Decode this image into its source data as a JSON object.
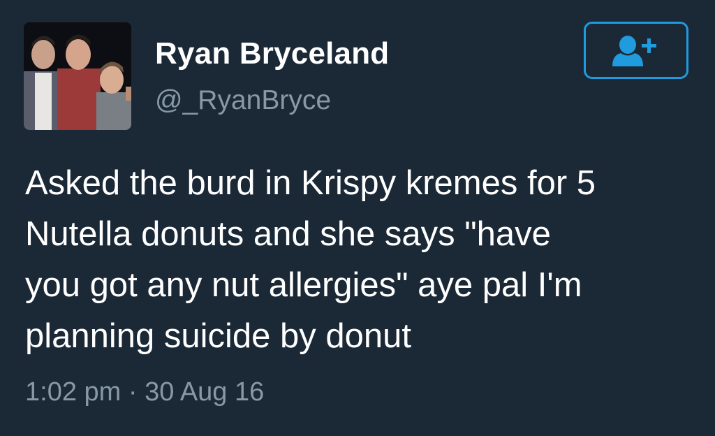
{
  "user": {
    "display_name": "Ryan Bryceland",
    "handle": "@_RyanBryce"
  },
  "follow_button": {
    "icon": "add-user-icon",
    "color": "#1f9bde"
  },
  "tweet": {
    "lines": [
      "Asked the burd in Krispy kremes for 5",
      "Nutella donuts and she says \"have",
      "you got any nut allergies\" aye pal I'm",
      "planning suicide by donut"
    ],
    "time": "1:02 pm",
    "separator": "·",
    "date": "30 Aug 16"
  },
  "colors": {
    "background": "#1b2836",
    "text": "#ffffff",
    "muted": "#8899a6",
    "accent": "#1f9bde"
  }
}
